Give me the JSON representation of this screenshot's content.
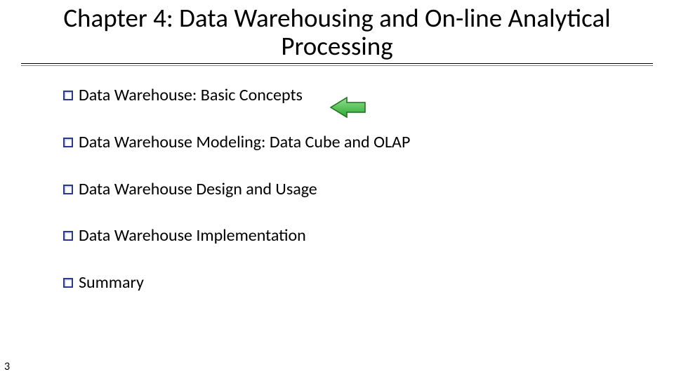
{
  "title": "Chapter 4: Data Warehousing and On-line Analytical Processing",
  "items": [
    "Data Warehouse: Basic Concepts",
    "Data Warehouse Modeling: Data Cube and OLAP",
    "Data Warehouse Design and Usage",
    "Data Warehouse Implementation",
    "Summary"
  ],
  "page_number": "3",
  "highlight_index": 0,
  "colors": {
    "bullet_border": "#2a3b8f",
    "arrow_fill_top": "#8fe08f",
    "arrow_fill_bottom": "#2fa82f",
    "arrow_stroke": "#1f6f1f"
  }
}
